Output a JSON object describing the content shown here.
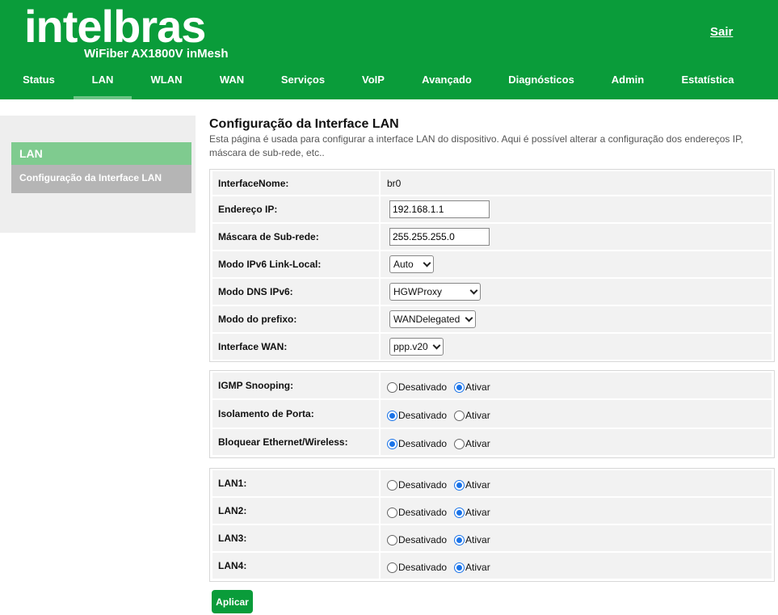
{
  "header": {
    "logo": "intelbras",
    "model": "WiFiber AX1800V inMesh",
    "logout": "Sair",
    "nav": [
      "Status",
      "LAN",
      "WLAN",
      "WAN",
      "Serviços",
      "VoIP",
      "Avançado",
      "Diagnósticos",
      "Admin",
      "Estatística"
    ],
    "active_tab": "LAN"
  },
  "sidebar": {
    "heading": "LAN",
    "items": [
      "Configuração da Interface LAN"
    ]
  },
  "page": {
    "title": "Configuração da Interface LAN",
    "description": "Esta página é usada para configurar a interface LAN do dispositivo. Aqui é possível alterar a configuração dos endereços IP, máscara de sub-rede, etc.."
  },
  "interface": {
    "name_label": "InterfaceNome:",
    "name_value": "br0",
    "ip_label": "Endereço IP:",
    "ip_value": "192.168.1.1",
    "mask_label": "Máscara de Sub-rede:",
    "mask_value": "255.255.255.0",
    "ipv6_label": "Modo IPv6 Link-Local:",
    "ipv6_value": "Auto",
    "dns_label": "Modo DNS IPv6:",
    "dns_value": "HGWProxy",
    "prefix_label": "Modo do prefixo:",
    "prefix_value": "WANDelegated",
    "wan_label": "Interface WAN:",
    "wan_value": "ppp.v20"
  },
  "options": {
    "off": "Desativado",
    "on": "Ativar",
    "igmp_label": "IGMP Snooping:",
    "igmp_state": "Ativar",
    "isolation_label": "Isolamento de Porta:",
    "isolation_state": "Desativado",
    "block_label": "Bloquear Ethernet/Wireless:",
    "block_state": "Desativado"
  },
  "lan_ports": [
    {
      "label": "LAN1:",
      "state": "Ativar"
    },
    {
      "label": "LAN2:",
      "state": "Ativar"
    },
    {
      "label": "LAN3:",
      "state": "Ativar"
    },
    {
      "label": "LAN4:",
      "state": "Ativar"
    }
  ],
  "apply": "Aplicar",
  "colors": {
    "brand_green": "#0a9c3a",
    "sidebar_heading": "#7fcb8f",
    "radio_selected": "#1a73e8"
  }
}
